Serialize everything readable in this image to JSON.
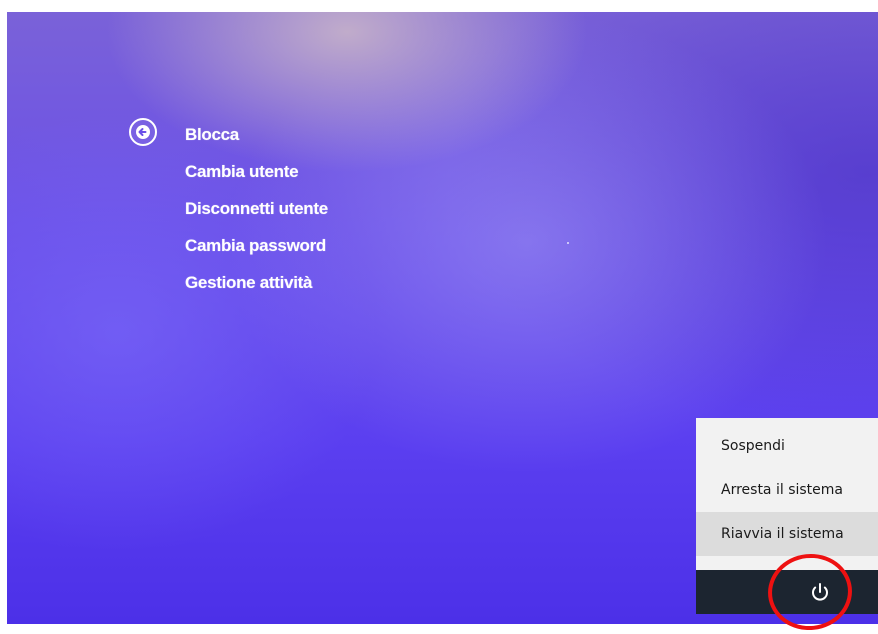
{
  "security_menu": {
    "items": [
      {
        "label": "Blocca"
      },
      {
        "label": "Cambia utente"
      },
      {
        "label": "Disconnetti utente"
      },
      {
        "label": "Cambia password"
      },
      {
        "label": "Gestione attività"
      }
    ],
    "back_icon": "back-arrow-icon"
  },
  "power_menu": {
    "items": [
      {
        "label": "Sospendi"
      },
      {
        "label": "Arresta il sistema"
      },
      {
        "label": "Riavvia il sistema",
        "highlighted": true
      }
    ],
    "power_icon": "power-icon"
  },
  "annotation": {
    "type": "circle",
    "color": "#ee1111",
    "target": "power-button"
  },
  "colors": {
    "background": "#5b3ff0",
    "menu_text": "#ffffff",
    "power_panel": "#1c2530",
    "power_menu_bg": "#f2f2f2"
  }
}
